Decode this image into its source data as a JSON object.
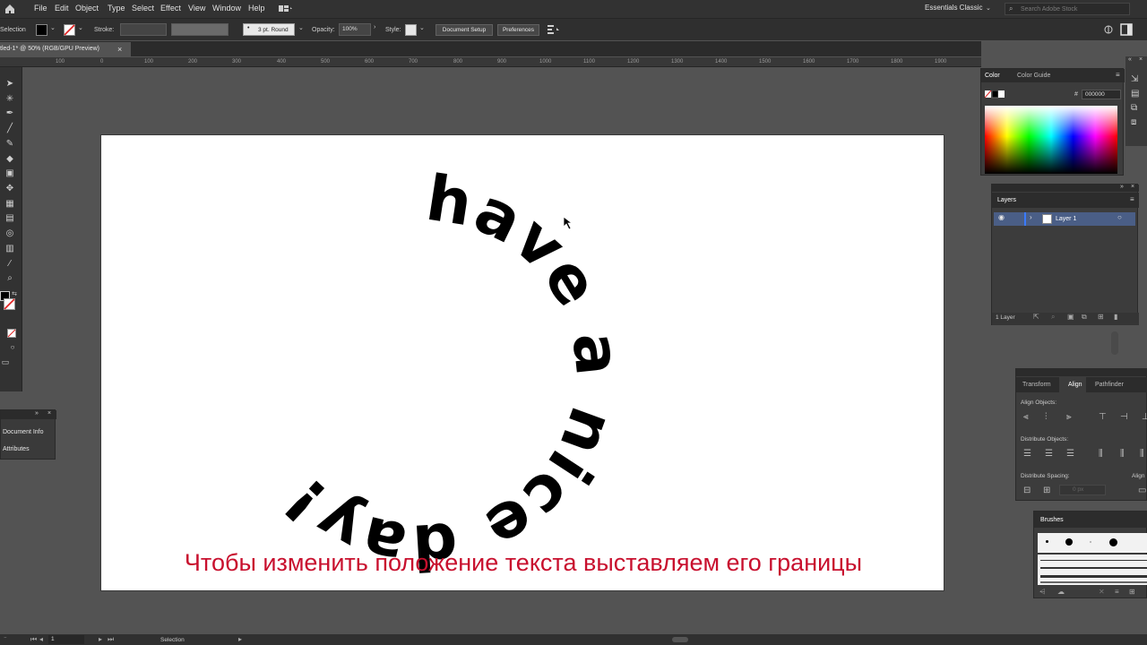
{
  "menu": {
    "items": [
      "File",
      "Edit",
      "Object",
      "Type",
      "Select",
      "Effect",
      "View",
      "Window",
      "Help"
    ],
    "workspace": "Essentials Classic",
    "search_placeholder": "Search Adobe Stock"
  },
  "control": {
    "selection_label": "Selection",
    "stroke_label": "Stroke:",
    "brush_value": "3 pt. Round",
    "opacity_label": "Opacity:",
    "opacity_value": "100%",
    "style_label": "Style:",
    "document_setup": "Document Setup",
    "preferences": "Preferences"
  },
  "document_tab": {
    "title": "tled-1* @ 50% (RGB/GPU Preview)",
    "close": "×"
  },
  "ruler_labels": [
    "100",
    "0",
    "100",
    "200",
    "300",
    "400",
    "500",
    "600",
    "700",
    "800",
    "900",
    "1000",
    "1100",
    "1200",
    "1300",
    "1400",
    "1500",
    "1600",
    "1700",
    "1800",
    "1900"
  ],
  "artwork": {
    "circle_text": "have a nice day!",
    "caption": "Чтобы изменить положение текста выставляем его границы"
  },
  "color_panel": {
    "tabs": [
      "Color",
      "Color Guide"
    ],
    "hex_label": "#",
    "hex_value": "000000"
  },
  "layers_panel": {
    "title": "Layers",
    "layer_name": "Layer 1",
    "count": "1 Layer"
  },
  "align_panel": {
    "tabs": [
      "Transform",
      "Align",
      "Pathfinder"
    ],
    "align_objects": "Align Objects:",
    "distribute_objects": "Distribute Objects:",
    "distribute_spacing": "Distribute Spacing:",
    "align_to": "Align",
    "spacing_value": "0 px"
  },
  "brushes_panel": {
    "title": "Brushes"
  },
  "left_panel": {
    "items": [
      "Document Info",
      "Attributes"
    ]
  },
  "status": {
    "zoom": "50%",
    "artboard": "1",
    "tool": "Selection"
  },
  "colors": {
    "caption": "#c8102e",
    "layer_highlight": "#4a5e86"
  }
}
